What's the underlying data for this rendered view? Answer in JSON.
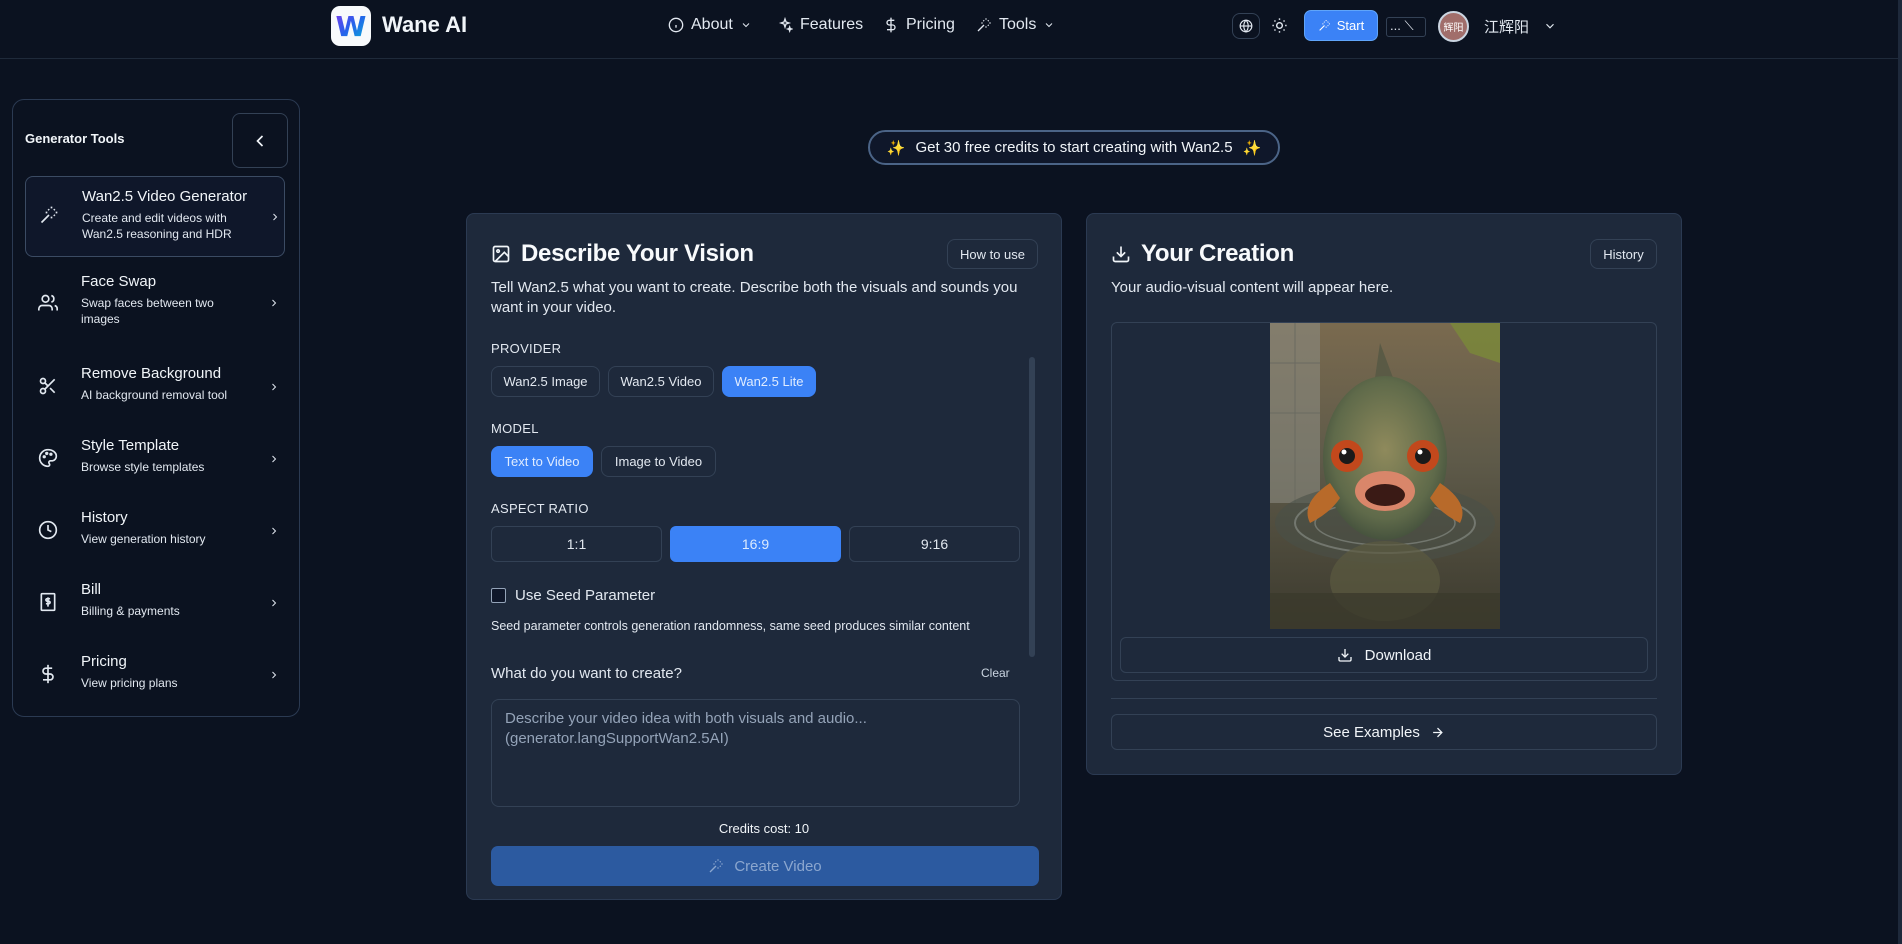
{
  "header": {
    "brand": "Wane AI",
    "logo_letter": "W",
    "nav": [
      {
        "label": "About",
        "icon": "info-icon",
        "dropdown": true
      },
      {
        "label": "Features",
        "icon": "sparkles-icon",
        "dropdown": false
      },
      {
        "label": "Pricing",
        "icon": "dollar-icon",
        "dropdown": false
      },
      {
        "label": "Tools",
        "icon": "wand-icon",
        "dropdown": true
      }
    ],
    "start_label": "Start",
    "more_label": "... ⟍",
    "avatar_text": "辉阳",
    "username": "江辉阳"
  },
  "sidebar": {
    "title": "Generator Tools",
    "items": [
      {
        "label": "Wan2.5 Video Generator",
        "desc": "Create and edit videos with Wan2.5 reasoning and HDR",
        "icon": "wand-icon",
        "active": true
      },
      {
        "label": "Face Swap",
        "desc": "Swap faces between two images",
        "icon": "users-icon"
      },
      {
        "label": "Remove Background",
        "desc": "AI background removal tool",
        "icon": "scissors-icon"
      },
      {
        "label": "Style Template",
        "desc": "Browse style templates",
        "icon": "palette-icon"
      },
      {
        "label": "History",
        "desc": "View generation history",
        "icon": "clock-icon"
      },
      {
        "label": "Bill",
        "desc": "Billing & payments",
        "icon": "receipt-icon"
      },
      {
        "label": "Pricing",
        "desc": "View pricing plans",
        "icon": "dollar-icon"
      }
    ]
  },
  "promo": {
    "text": "Get 30 free credits to start creating with Wan2.5",
    "emoji": "✨"
  },
  "left_panel": {
    "title": "Describe Your Vision",
    "how_to_use": "How to use",
    "subtitle": "Tell Wan2.5 what you want to create. Describe both the visuals and sounds you want in your video.",
    "provider_label": "PROVIDER",
    "providers": [
      "Wan2.5 Image",
      "Wan2.5 Video",
      "Wan2.5 Lite"
    ],
    "provider_selected": "Wan2.5 Lite",
    "model_label": "MODEL",
    "models": [
      "Text to Video",
      "Image to Video"
    ],
    "model_selected": "Text to Video",
    "aspect_label": "ASPECT RATIO",
    "aspects": [
      "1:1",
      "16:9",
      "9:16"
    ],
    "aspect_selected": "16:9",
    "seed_label": "Use Seed Parameter",
    "seed_help": "Seed parameter controls generation randomness, same seed produces similar content",
    "prompt_question": "What do you want to create?",
    "clear": "Clear",
    "prompt_placeholder": "Describe your video idea with both visuals and audio...\n(generator.langSupportWan2.5AI)",
    "credits_cost": "Credits cost: 10",
    "create_button": "Create Video"
  },
  "right_panel": {
    "title": "Your Creation",
    "history_button": "History",
    "subtitle": "Your audio-visual content will appear here.",
    "download": "Download",
    "see_examples": "See Examples"
  }
}
